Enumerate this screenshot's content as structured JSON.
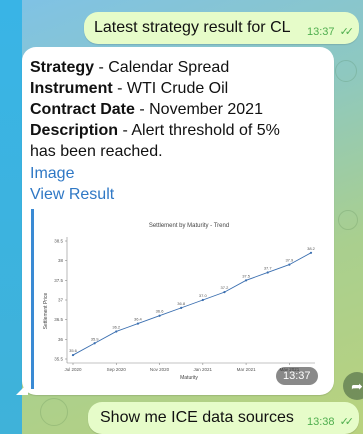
{
  "messages": {
    "m1": {
      "text": "Latest strategy result for CL",
      "time": "13:37"
    },
    "m2": {
      "strategy_label": "Strategy",
      "strategy_value": " - Calendar Spread",
      "instrument_label": "Instrument",
      "instrument_value": " - WTI Crude Oil",
      "contract_label": "Contract Date",
      "contract_value": " - November 2021",
      "description_label": "Description",
      "description_value": " - Alert threshold of 5%",
      "description_cont": "has been reached.",
      "image_link": "Image",
      "result_link": "View Result",
      "time": "13:37"
    },
    "m3": {
      "text": "Show me ICE data sources",
      "time": "13:38"
    }
  },
  "icons": {
    "read": "double-check-icon",
    "share": "share-arrow-icon"
  },
  "colors": {
    "outgoing": "#e6fcc9",
    "incoming": "#ffffff",
    "link": "#2f78c5",
    "timestamp": "#4fae4e"
  },
  "chart_data": {
    "type": "line",
    "title": "Settlement by Maturity - Trend",
    "xlabel": "Maturity",
    "ylabel": "Settlement Price",
    "x_ticks": [
      "Jul 2020",
      "Sep 2020",
      "Nov 2020",
      "Jan 2021",
      "Mar 2021",
      "May 2021"
    ],
    "y_ticks": [
      35.5,
      36,
      36.5,
      37,
      37.5,
      38,
      38.5
    ],
    "ylim": [
      35.5,
      38.5
    ],
    "x": [
      "Jul 2020",
      "Aug 2020",
      "Sep 2020",
      "Oct 2020",
      "Nov 2020",
      "Dec 2020",
      "Jan 2021",
      "Feb 2021",
      "Mar 2021",
      "Apr 2021",
      "May 2021",
      "Jun 2021"
    ],
    "values": [
      35.6,
      35.9,
      36.2,
      36.4,
      36.6,
      36.8,
      37.0,
      37.2,
      37.5,
      37.7,
      37.9,
      38.2
    ],
    "point_labels": [
      "35.6",
      "35.9",
      "36.2",
      "36.4",
      "36.6",
      "36.8",
      "37.0",
      "37.2",
      "37.5",
      "37.7",
      "37.9",
      "38.2"
    ],
    "grid": false
  }
}
